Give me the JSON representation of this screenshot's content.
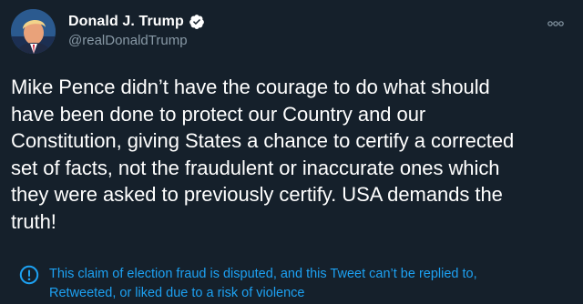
{
  "tweet": {
    "display_name": "Donald J. Trump",
    "handle": "@realDonaldTrump",
    "body": "Mike Pence didn’t have the courage to do what should\nhave been done to protect our Country and our\nConstitution, giving States a chance to certify a corrected\nset of facts, not the fraudulent or inaccurate ones which\nthey were asked to previously certify. USA demands the\ntruth!",
    "notice": "This claim of election fraud is disputed, and this Tweet can’t be replied to,\nRetweeted, or liked due to a risk of violence"
  },
  "icons": {
    "verified": "verified-badge-icon",
    "more": "more-options-icon",
    "notice": "info-circle-icon"
  },
  "colors": {
    "background": "#15202b",
    "text": "#ffffff",
    "secondary_text": "#8899a6",
    "accent": "#1da1f2"
  }
}
